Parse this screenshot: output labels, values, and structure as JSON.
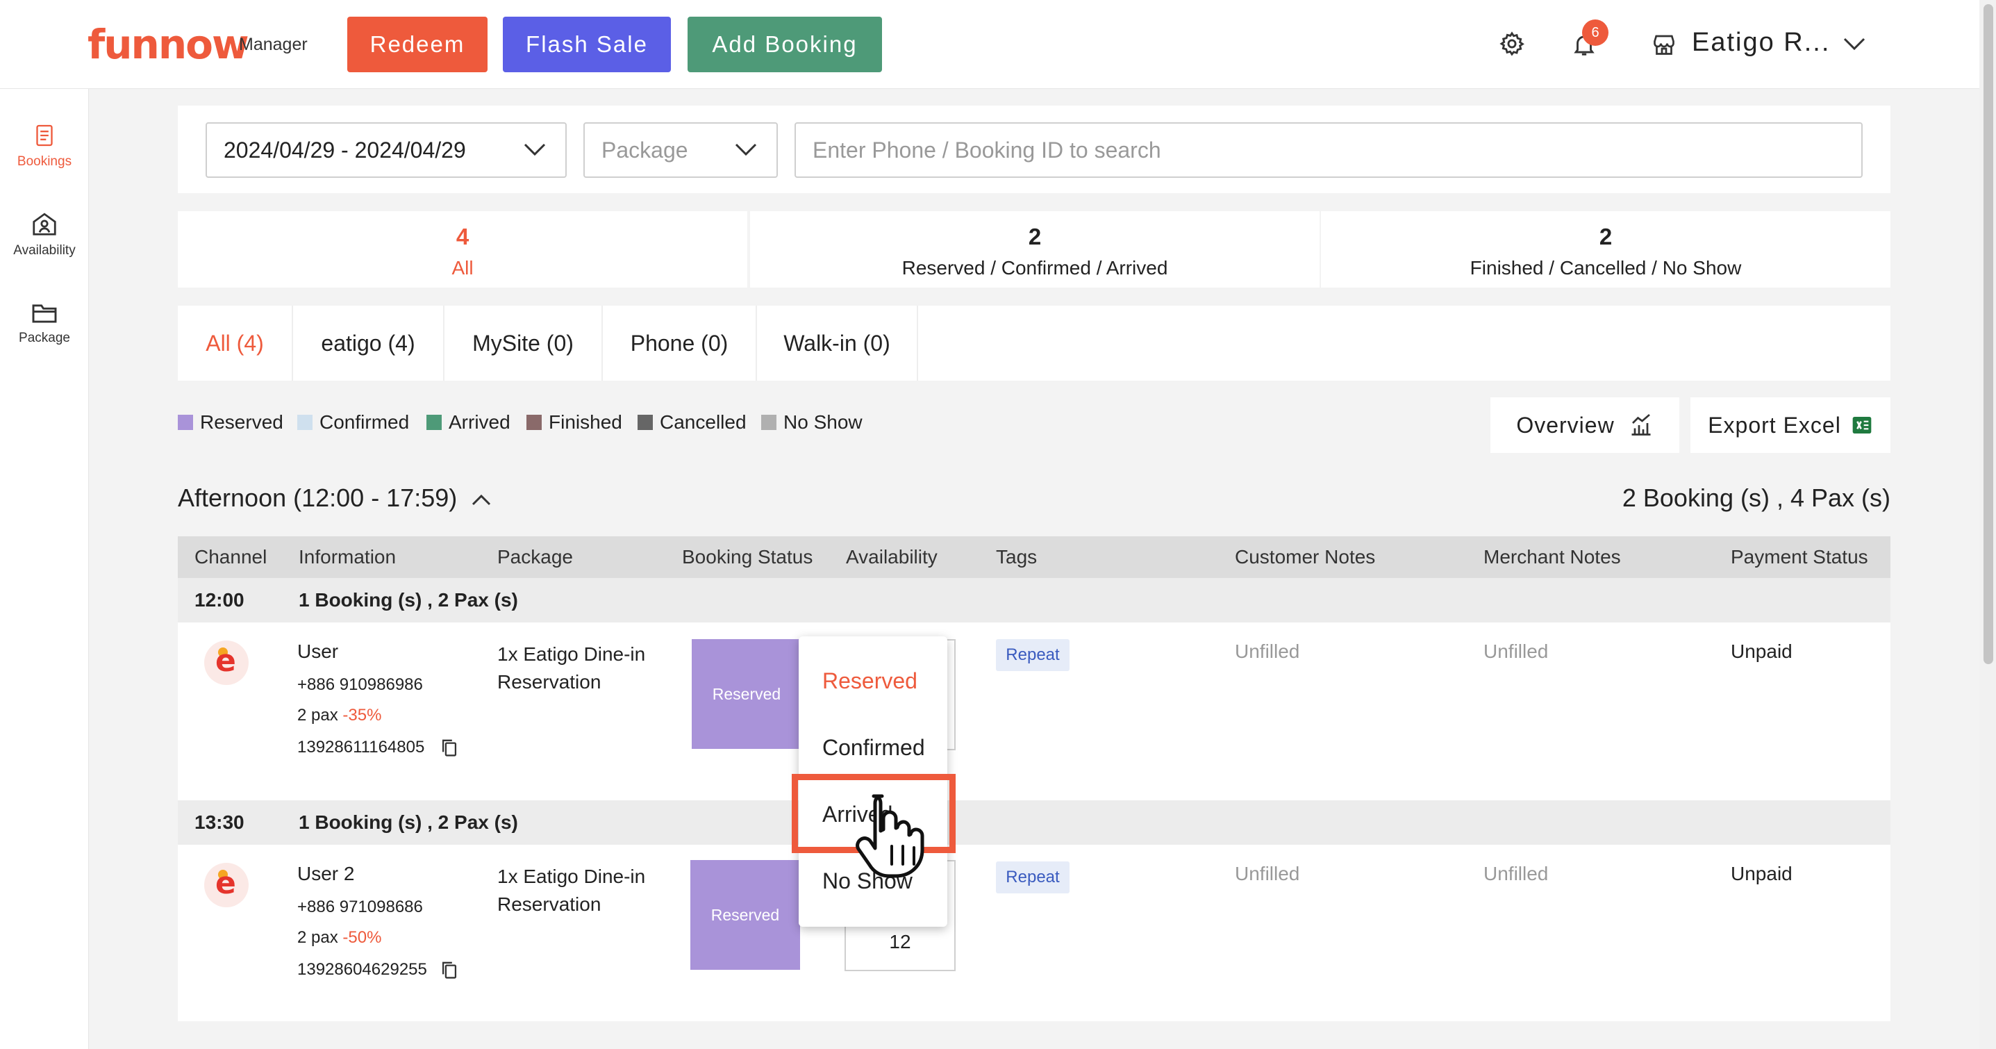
{
  "header": {
    "logo": "funnow",
    "logo_sub": "Manager",
    "redeem_label": "Redeem",
    "flash_sale_label": "Flash Sale",
    "add_booking_label": "Add Booking",
    "notification_count": "6",
    "store_name": "Eatigo R...",
    "colors": {
      "brand": "#ee5a3c",
      "flash": "#5b5fe6",
      "add": "#4e9a78"
    }
  },
  "sidebar": {
    "items": [
      {
        "label": "Bookings",
        "icon": "document-icon",
        "active": true
      },
      {
        "label": "Availability",
        "icon": "store-user-icon"
      },
      {
        "label": "Package",
        "icon": "folder-icon"
      }
    ]
  },
  "filters": {
    "date_range": "2024/04/29 - 2024/04/29",
    "package_placeholder": "Package",
    "search_placeholder": "Enter Phone / Booking ID to search"
  },
  "stats": [
    {
      "count": "4",
      "label": "All"
    },
    {
      "count": "2",
      "label": "Reserved / Confirmed / Arrived"
    },
    {
      "count": "2",
      "label": "Finished / Cancelled / No Show"
    }
  ],
  "channel_tabs": [
    "All (4)",
    "eatigo (4)",
    "MySite (0)",
    "Phone (0)",
    "Walk-in (0)"
  ],
  "legend": [
    {
      "label": "Reserved",
      "color": "#a993d9"
    },
    {
      "label": "Confirmed",
      "color": "#cfe0ee"
    },
    {
      "label": "Arrived",
      "color": "#4e9a78"
    },
    {
      "label": "Finished",
      "color": "#8a6a6a"
    },
    {
      "label": "Cancelled",
      "color": "#666666"
    },
    {
      "label": "No Show",
      "color": "#b0b0b0"
    }
  ],
  "actions": {
    "overview_label": "Overview",
    "export_label": "Export Excel"
  },
  "section": {
    "title": "Afternoon (12:00 - 17:59)",
    "summary": "2 Booking (s) , 4 Pax (s)"
  },
  "columns": [
    "Channel",
    "Information",
    "Package",
    "Booking Status",
    "Availability",
    "Tags",
    "Customer Notes",
    "Merchant Notes",
    "Payment Status"
  ],
  "groups": [
    {
      "time": "12:00",
      "summary": "1 Booking (s) , 2 Pax (s)",
      "booking": {
        "name": "User",
        "phone": "+886 910986986",
        "pax": "2 pax",
        "discount": "-35%",
        "booking_id": "13928611164805",
        "package": "1x Eatigo Dine-in Reservation",
        "status": "Reserved",
        "availability": "",
        "tag": "Repeat",
        "customer_notes": "Unfilled",
        "merchant_notes": "Unfilled",
        "payment": "Unpaid"
      }
    },
    {
      "time": "13:30",
      "summary": "1 Booking (s) , 2 Pax (s)",
      "booking": {
        "name": "User 2",
        "phone": "+886 971098686",
        "pax": "2 pax",
        "discount": "-50%",
        "booking_id": "13928604629255",
        "package": "1x Eatigo Dine-in Reservation",
        "status": "Reserved",
        "availability": "12",
        "tag": "Repeat",
        "customer_notes": "Unfilled",
        "merchant_notes": "Unfilled",
        "payment": "Unpaid"
      }
    }
  ],
  "status_menu": {
    "options": [
      "Reserved",
      "Confirmed",
      "Arrived",
      "No Show"
    ],
    "selected": "Reserved",
    "highlighted": "Arrived"
  }
}
